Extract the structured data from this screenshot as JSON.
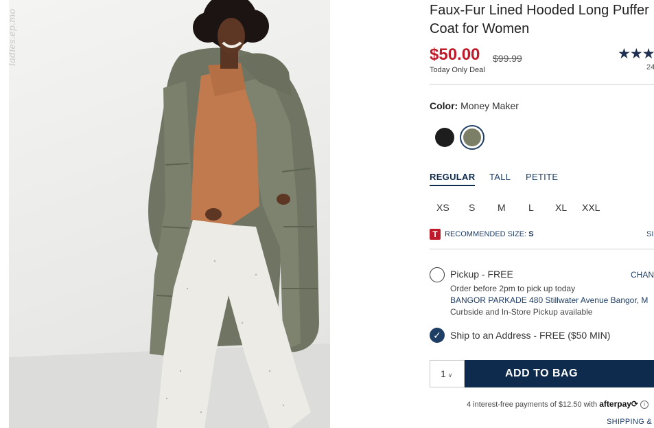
{
  "product": {
    "title": "Faux-Fur Lined Hooded Long Puffer\nCoat for Women",
    "sale_price": "$50.00",
    "original_price": "$99.99",
    "deal_label": "Today Only Deal",
    "stars": "★★★",
    "review_count": "24",
    "watermark": "ladies.ep.mo"
  },
  "color": {
    "label": "Color:",
    "value": "Money Maker",
    "swatches": [
      {
        "name": "black",
        "hex": "#1d1d1d",
        "selected": false
      },
      {
        "name": "money-maker",
        "hex": "#7b7f66",
        "selected": true
      }
    ]
  },
  "fit_tabs": [
    "REGULAR",
    "TALL",
    "PETITE"
  ],
  "sizes": [
    "XS",
    "S",
    "M",
    "L",
    "XL",
    "XXL"
  ],
  "recommended": {
    "icon_letter": "T",
    "label": "RECOMMENDED SIZE:",
    "size": "S",
    "size_chart_link": "SI"
  },
  "pickup": {
    "title": "Pickup - FREE",
    "change_link": "CHANG",
    "order_note": "Order before 2pm to pick up today",
    "store": "BANGOR PARKADE 480 Stillwater Avenue  Bangor, M",
    "availability": "Curbside and In-Store Pickup available"
  },
  "ship": {
    "label": "Ship to an Address - FREE ($50 MIN)",
    "checkmark": "✓"
  },
  "cart": {
    "quantity": "1",
    "caret": "∨",
    "add_to_bag": "ADD TO BAG"
  },
  "afterpay": {
    "text": "4 interest-free payments of $12.50 with",
    "logo": "afterpay",
    "logo_mark": "⟳",
    "info": "i"
  },
  "shipping_link": "SHIPPING & R",
  "colors": {
    "sale_red": "#c01b2b",
    "navy": "#0e2a4d",
    "link_blue": "#1f3e66"
  }
}
